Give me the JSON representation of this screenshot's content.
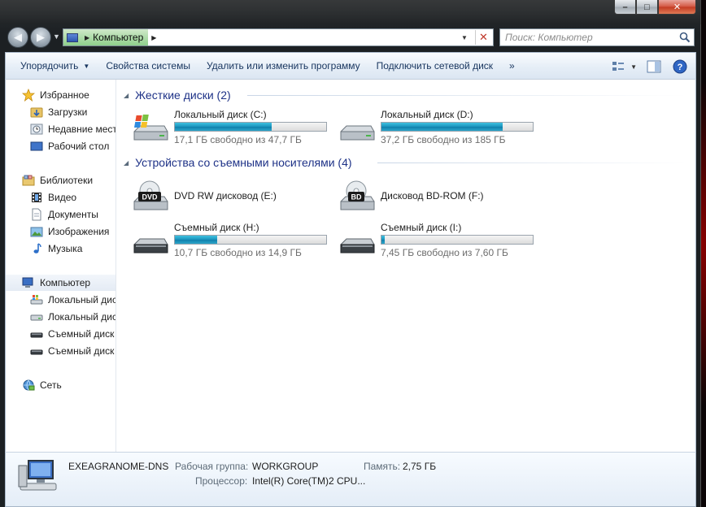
{
  "window": {
    "caption": {
      "minimize": "–",
      "maximize": "□",
      "close": "✕"
    }
  },
  "nav": {
    "back": "◀",
    "forward": "▶",
    "address_crumb": "Компьютер",
    "search_placeholder": "Поиск: Компьютер"
  },
  "commands": {
    "organize": "Упорядочить",
    "system_properties": "Свойства системы",
    "uninstall": "Удалить или изменить программу",
    "map_drive": "Подключить сетевой диск",
    "more": "»"
  },
  "sidebar": {
    "favorites": {
      "header": "Избранное",
      "items": [
        "Загрузки",
        "Недавние места",
        "Рабочий стол"
      ]
    },
    "libraries": {
      "header": "Библиотеки",
      "items": [
        "Видео",
        "Документы",
        "Изображения",
        "Музыка"
      ]
    },
    "computer": {
      "header": "Компьютер",
      "items": [
        "Локальный диск (C:)",
        "Локальный диск (D:)",
        "Съемный диск (H:)",
        "Съемный диск (I:)"
      ]
    },
    "network": {
      "header": "Сеть"
    }
  },
  "groups": {
    "hard_drives": {
      "header": "Жесткие диски (2)"
    },
    "removable": {
      "header": "Устройства со съемными носителями (4)"
    }
  },
  "drives": [
    {
      "name": "Локальный диск (C:)",
      "free": "17,1 ГБ свободно из 47,7 ГБ",
      "used_fraction": 0.64,
      "icon": "windows-drive-icon"
    },
    {
      "name": "Локальный диск (D:)",
      "free": "37,2 ГБ свободно из 185 ГБ",
      "used_fraction": 0.8,
      "icon": "hard-drive-icon"
    }
  ],
  "optical": [
    {
      "name": "DVD RW дисковод (E:)",
      "badge": "DVD",
      "icon": "dvd-drive-icon"
    },
    {
      "name": "Дисковод BD-ROM (F:)",
      "badge": "BD",
      "icon": "bd-drive-icon"
    }
  ],
  "removable": [
    {
      "name": "Съемный диск (H:)",
      "free": "10,7 ГБ свободно из 14,9 ГБ",
      "used_fraction": 0.28,
      "icon": "removable-drive-icon"
    },
    {
      "name": "Съемный диск (I:)",
      "free": "7,45 ГБ свободно из 7,60 ГБ",
      "used_fraction": 0.02,
      "icon": "removable-drive-icon"
    }
  ],
  "details": {
    "computer_name": "EXEAGRANOME-DNS",
    "workgroup_label": "Рабочая группа:",
    "workgroup_value": "WORKGROUP",
    "memory_label": "Память:",
    "memory_value": "2,75 ГБ",
    "cpu_label": "Процессор:",
    "cpu_value": "Intel(R) Core(TM)2 CPU..."
  },
  "colors": {
    "accent_header": "#1e3287",
    "bar_fill": "#1a93bd",
    "command_text": "#1a3760"
  }
}
